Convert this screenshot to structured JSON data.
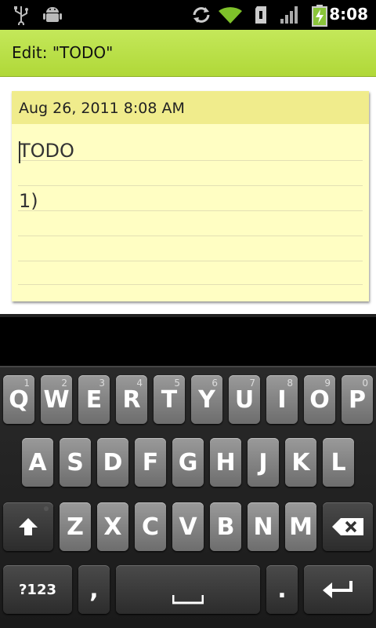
{
  "status": {
    "time": "8:08"
  },
  "title": "Edit: \"TODO\"",
  "note": {
    "date": "Aug 26, 2011 8:08 AM",
    "lines": [
      "TODO",
      "1)"
    ]
  },
  "keyboard": {
    "row1": [
      {
        "label": "Q",
        "hint": "1"
      },
      {
        "label": "W",
        "hint": "2"
      },
      {
        "label": "E",
        "hint": "3"
      },
      {
        "label": "R",
        "hint": "4"
      },
      {
        "label": "T",
        "hint": "5"
      },
      {
        "label": "Y",
        "hint": "6"
      },
      {
        "label": "U",
        "hint": "7"
      },
      {
        "label": "I",
        "hint": "8"
      },
      {
        "label": "O",
        "hint": "9"
      },
      {
        "label": "P",
        "hint": "0"
      }
    ],
    "row2": [
      "A",
      "S",
      "D",
      "F",
      "G",
      "H",
      "J",
      "K",
      "L"
    ],
    "row3": [
      "Z",
      "X",
      "C",
      "V",
      "B",
      "N",
      "M"
    ],
    "symbols_label": "?123",
    "comma_label": ",",
    "period_label": "."
  },
  "colors": {
    "title_bar": "#b6dc40",
    "note_body": "#fffec3",
    "note_header": "#f0ec8c",
    "wifi": "#7ec12a",
    "battery": "#8ac43a"
  },
  "icons": {
    "usb": "usb-icon",
    "android": "android-debug-icon",
    "sync": "sync-icon",
    "wifi": "wifi-icon",
    "sd": "sd-card-icon",
    "signal": "signal-icon",
    "battery": "battery-charging-icon",
    "shift": "shift-icon",
    "backspace": "backspace-icon",
    "enter": "enter-icon",
    "space": "space-icon"
  }
}
